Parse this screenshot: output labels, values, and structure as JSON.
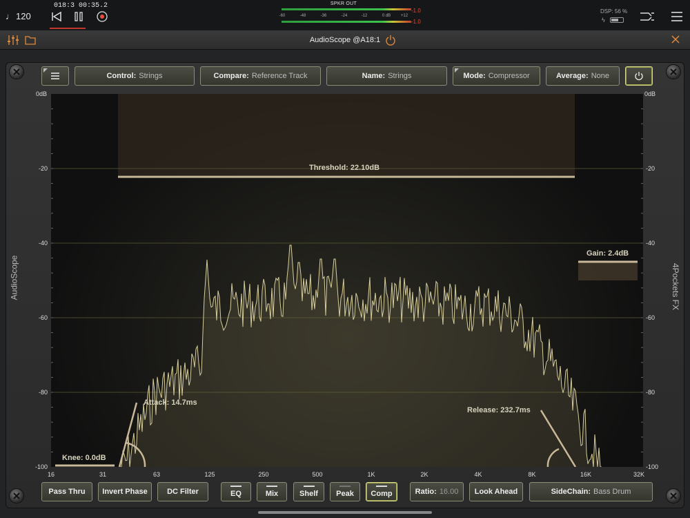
{
  "transport": {
    "tempo": "120",
    "bar_position": "018:3",
    "time_position": "00:35.2"
  },
  "meter": {
    "title": "SPKR OUT",
    "scale": [
      "-60",
      "-48",
      "-36",
      "-24",
      "-12",
      "0 dB",
      "+12"
    ],
    "peak_top": "-1.0",
    "peak_bottom": "-1.0"
  },
  "status": {
    "dsp": "DSP: 56 %"
  },
  "plugin": {
    "title": "AudioScope @A18:1"
  },
  "side_labels": {
    "left": "AudioScope",
    "right": "4Pockets FX"
  },
  "top_controls": {
    "control": {
      "key": "Control:",
      "value": "Strings"
    },
    "compare": {
      "key": "Compare:",
      "value": "Reference Track"
    },
    "name": {
      "key": "Name:",
      "value": "Strings"
    },
    "mode": {
      "key": "Mode:",
      "value": "Compressor"
    },
    "average": {
      "key": "Average:",
      "value": "None"
    }
  },
  "bottom_controls": {
    "pass_thru": "Pass Thru",
    "invert_phase": "Invert Phase",
    "dc_filter": "DC Filter",
    "eq": "EQ",
    "mix": "Mix",
    "shelf": "Shelf",
    "peak": "Peak",
    "comp": "Comp",
    "ratio": {
      "key": "Ratio:",
      "value": "16.00"
    },
    "look_ahead": "Look Ahead",
    "sidechain": {
      "key": "SideChain:",
      "value": "Bass Drum"
    }
  },
  "plot": {
    "db_labels": [
      "0dB",
      "-20",
      "-40",
      "-60",
      "-80",
      "-100"
    ],
    "freq_labels": [
      "16",
      "31",
      "63",
      "125",
      "250",
      "500",
      "1K",
      "2K",
      "4K",
      "8K",
      "16K",
      "32K"
    ],
    "threshold_label": "Threshold: 22.10dB",
    "gain_label": "Gain: 2.4dB",
    "attack_label": "Attack: 14.7ms",
    "release_label": "Release: 232.7ms",
    "knee_label": "Knee: 0.0dB",
    "accent_color": "#c9b99a"
  }
}
